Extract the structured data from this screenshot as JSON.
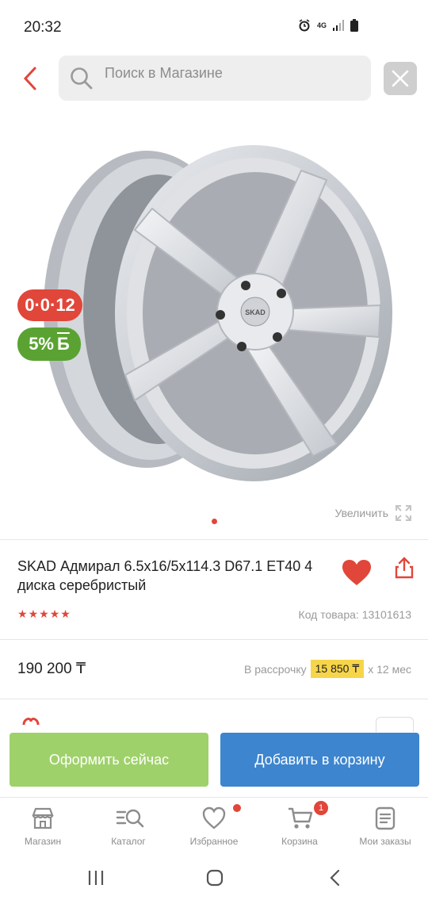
{
  "status": {
    "time": "20:32",
    "network": "4G"
  },
  "search": {
    "placeholder": "Поиск в Магазине"
  },
  "badges": {
    "timer": "0·0·12",
    "discount": "5%",
    "discount_suffix": "Б"
  },
  "gallery": {
    "zoom_label": "Увеличить",
    "wheel_logo": "SKAD"
  },
  "product": {
    "title": "SKAD Адмирал 6.5x16/5x114.3 D67.1 ET40 4 диска серебристый",
    "rating_stars": 5,
    "code": "Код товара: 13101613",
    "price": "190 200 ₸",
    "installment_prefix": "В рассрочку",
    "installment_amount": "15 850 ₸",
    "installment_suffix": "x 12 мес"
  },
  "actions": {
    "buy_now": "Оформить сейчас",
    "add_to_cart": "Добавить в корзину"
  },
  "tabs": [
    {
      "label": "Магазин"
    },
    {
      "label": "Каталог"
    },
    {
      "label": "Избранное"
    },
    {
      "label": "Корзина",
      "badge": "1"
    },
    {
      "label": "Мои заказы"
    }
  ],
  "colors": {
    "accent": "#e1463a",
    "buy": "#9fd16b",
    "cart": "#3d85cf",
    "discount": "#5aa332",
    "installment": "#f6d54a"
  }
}
